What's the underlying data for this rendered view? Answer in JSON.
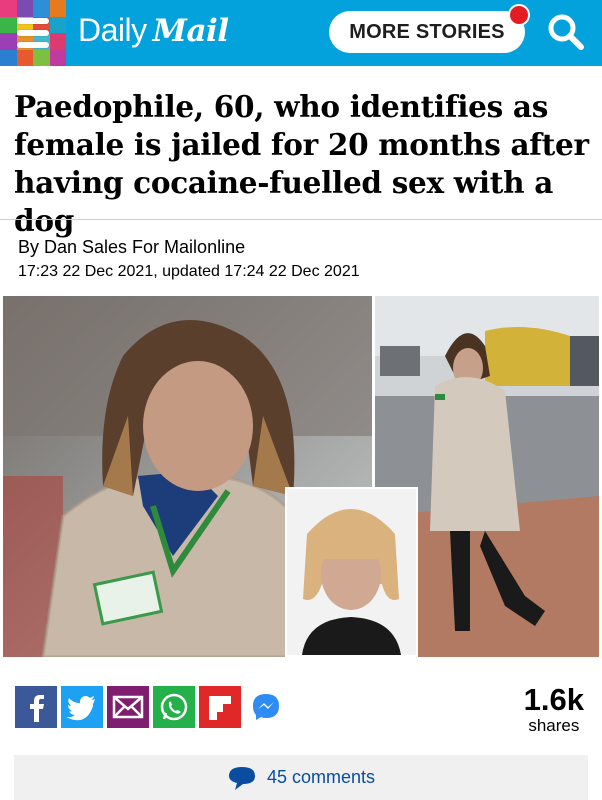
{
  "header": {
    "logo_daily": "Daily",
    "logo_mail": "Mail",
    "more_stories_label": "MORE STORIES",
    "brand_color": "#03a2dc",
    "notification_color": "#e41c23",
    "icons": [
      "menu-icon",
      "search-icon"
    ]
  },
  "article": {
    "headline": "Paedophile, 60, who identifies as female is jailed for 20 months after having cocaine-fuelled sex with a dog",
    "byline": "By Dan Sales For Mailonline",
    "timestamp": "17:23 22 Dec 2021, updated 17:24 22 Dec 2021"
  },
  "share": {
    "buttons": [
      {
        "name": "facebook-share-button",
        "icon": "facebook-icon",
        "color": "#3b5998"
      },
      {
        "name": "twitter-share-button",
        "icon": "twitter-icon",
        "color": "#1da1f2"
      },
      {
        "name": "email-share-button",
        "icon": "email-icon",
        "color": "#7f1d6f"
      },
      {
        "name": "whatsapp-share-button",
        "icon": "whatsapp-icon",
        "color": "#25b14a"
      },
      {
        "name": "flipboard-share-button",
        "icon": "flipboard-icon",
        "color": "#e12828"
      },
      {
        "name": "messenger-share-button",
        "icon": "messenger-icon",
        "color": "#2f8cf5"
      }
    ],
    "count": "1.6k",
    "count_label": "shares"
  },
  "comments": {
    "label": "45 comments",
    "icon": "comment-bubble-icon",
    "link_color": "#0a4da0"
  }
}
